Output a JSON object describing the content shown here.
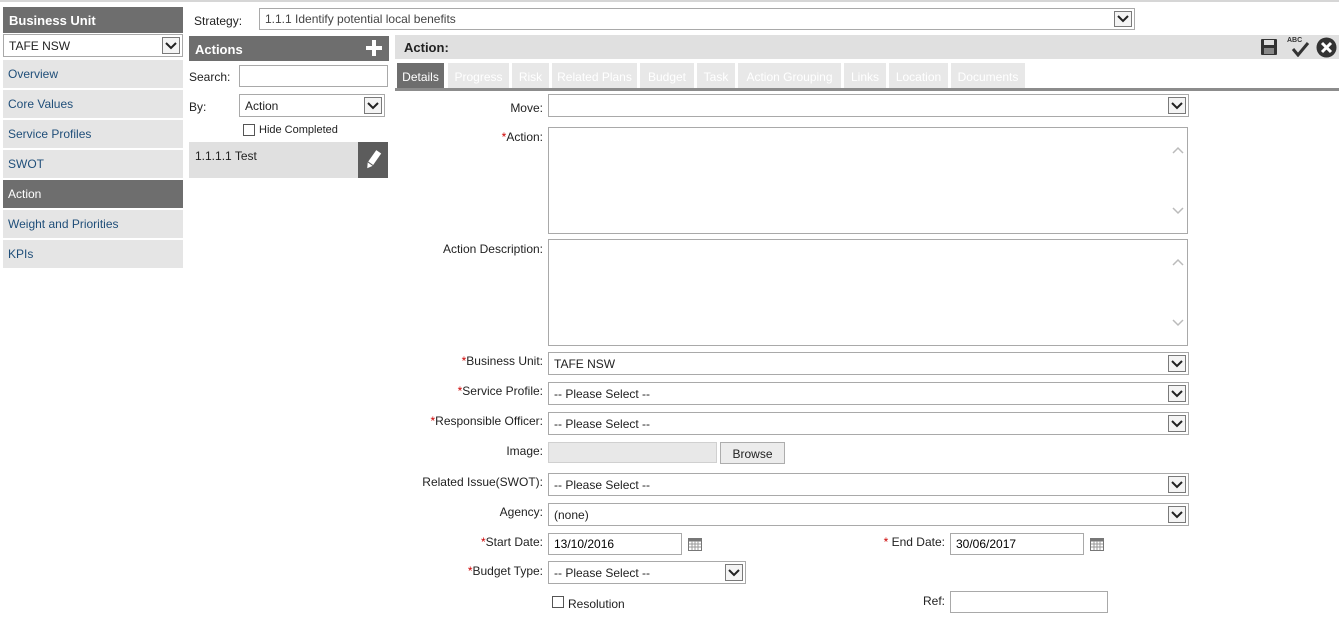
{
  "left_nav": {
    "header": "Business Unit",
    "business_unit_select": "TAFE NSW",
    "items": [
      {
        "label": "Overview",
        "active": false
      },
      {
        "label": "Core Values",
        "active": false
      },
      {
        "label": "Service Profiles",
        "active": false
      },
      {
        "label": "SWOT",
        "active": false
      },
      {
        "label": "Action",
        "active": true
      },
      {
        "label": "Weight and Priorities",
        "active": false
      },
      {
        "label": "KPIs",
        "active": false
      }
    ]
  },
  "strategy": {
    "label": "Strategy:",
    "value": "1.1.1 Identify potential local benefits"
  },
  "actions_panel": {
    "header": "Actions",
    "search_label": "Search:",
    "search_value": "",
    "by_label": "By:",
    "by_value": "Action",
    "hide_completed_label": "Hide Completed",
    "items": [
      "1.1.1.1 Test"
    ]
  },
  "detail": {
    "header": "Action:",
    "tabs": [
      {
        "label": "Details",
        "active": true
      },
      {
        "label": "Progress",
        "active": false
      },
      {
        "label": "Risk",
        "active": false
      },
      {
        "label": "Related Plans",
        "active": false
      },
      {
        "label": "Budget",
        "active": false
      },
      {
        "label": "Task",
        "active": false
      },
      {
        "label": "Action Grouping",
        "active": false
      },
      {
        "label": "Links",
        "active": false
      },
      {
        "label": "Location",
        "active": false
      },
      {
        "label": "Documents",
        "active": false
      }
    ],
    "toolbar": {
      "save_icon": "save-icon",
      "spellcheck_icon": "spellcheck-icon",
      "spellcheck_text": "ABC",
      "close_icon": "close-icon"
    },
    "fields": {
      "move": {
        "label": "Move:",
        "value": ""
      },
      "action": {
        "required": "*",
        "label": "Action:",
        "value": ""
      },
      "action_description": {
        "label": "Action Description:",
        "value": ""
      },
      "business_unit": {
        "required": "*",
        "label": "Business Unit:",
        "value": "TAFE NSW"
      },
      "service_profile": {
        "required": "*",
        "label": "Service Profile:",
        "value": "-- Please Select --"
      },
      "responsible_officer": {
        "required": "*",
        "label": "Responsible Officer:",
        "value": "-- Please Select --"
      },
      "image": {
        "label": "Image:",
        "value": "",
        "browse_label": "Browse"
      },
      "related_issue": {
        "label": "Related Issue(SWOT):",
        "value": "-- Please Select --"
      },
      "agency": {
        "label": "Agency:",
        "value": "(none)"
      },
      "start_date": {
        "required": "*",
        "label": "Start Date:",
        "value": "13/10/2016"
      },
      "end_date": {
        "required": "* ",
        "label": "End Date:",
        "value": "30/06/2017"
      },
      "budget_type": {
        "required": "*",
        "label": "Budget Type:",
        "value": "-- Please Select --"
      },
      "resolution": {
        "label": "Resolution",
        "checked": false
      },
      "ref": {
        "label": "Ref:",
        "value": ""
      }
    }
  },
  "colors": {
    "header_gray": "#6e6e6e",
    "nav_link": "#1f4e79",
    "required": "#cc0000",
    "light_panel": "#e0e0e0"
  }
}
